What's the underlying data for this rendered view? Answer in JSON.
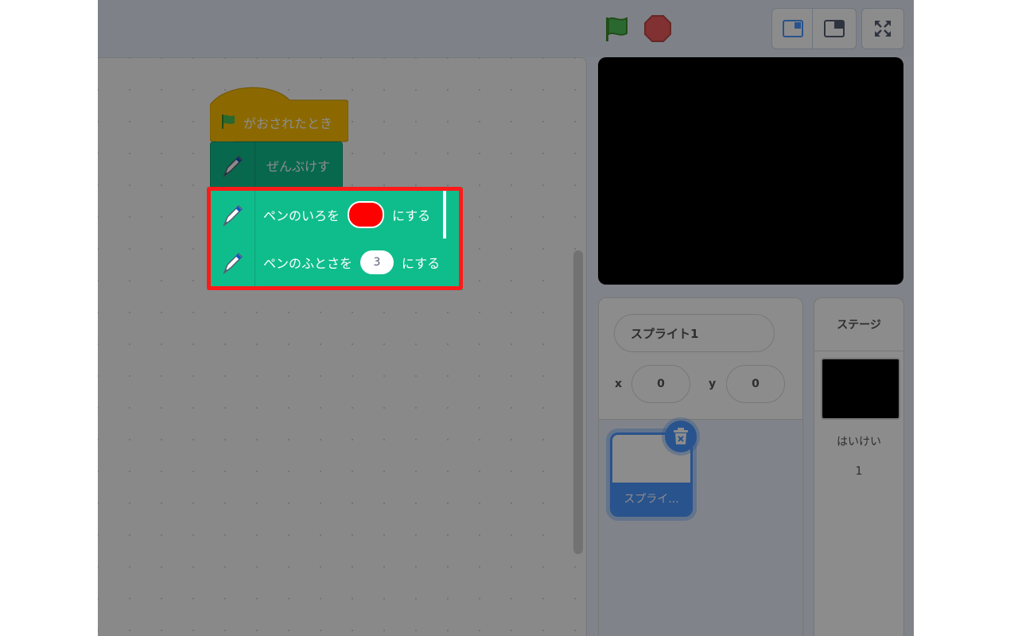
{
  "header": {
    "green_flag_icon": "green-flag-icon",
    "stop_icon": "stop-icon",
    "small_stage_icon": "small-stage-icon",
    "normal_stage_icon": "normal-stage-icon",
    "fullscreen_icon": "fullscreen-icon"
  },
  "blocks": {
    "hat_label": "がおされたとき",
    "clear_label": "ぜんぶけす",
    "pen_color_prefix": "ペンのいろを",
    "pen_color_suffix": "にする",
    "pen_color_value": "#ff0000",
    "pen_size_prefix": "ペンのふとさを",
    "pen_size_value": "3",
    "pen_size_suffix": "にする"
  },
  "sprite_info": {
    "name": "スプライト1",
    "x_label": "x",
    "x_value": "0",
    "y_label": "y",
    "y_value": "0"
  },
  "sprite_list": {
    "items": [
      {
        "label": "スプライ..."
      }
    ],
    "delete_icon": "trash-icon"
  },
  "stage_panel": {
    "title": "ステージ",
    "backdrop_label": "はいけい",
    "backdrop_count": "1"
  },
  "colors": {
    "accent": "#4c97ff",
    "pen_block": "#0fbd8c",
    "event_block": "#ffbf00",
    "highlight": "#ff1a1a"
  }
}
